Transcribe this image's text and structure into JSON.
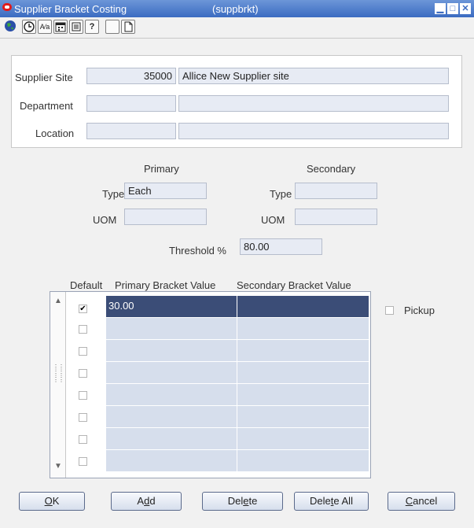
{
  "window": {
    "title": "Supplier Bracket Costing",
    "subtitle": "(suppbrkt)",
    "controls": [
      "minimize",
      "maximize",
      "close"
    ]
  },
  "toolbar": {
    "icons": [
      "globe-icon",
      "clock-icon",
      "find-icon",
      "calendar-icon",
      "form-icon",
      "help-icon",
      "blank-icon",
      "new-doc-icon"
    ]
  },
  "header": {
    "supplier_site_label": "Supplier Site",
    "supplier_site_id": "35000",
    "supplier_site_name": "Allice New Supplier site",
    "department_label": "Department",
    "department_id": "",
    "department_name": "",
    "location_label": "Location",
    "location_id": "",
    "location_name": ""
  },
  "uom_section": {
    "primary_label": "Primary",
    "secondary_label": "Secondary",
    "primary_type_label": "Type",
    "primary_type_value": "Each",
    "primary_uom_label": "UOM",
    "primary_uom_value": "",
    "secondary_type_label": "Type",
    "secondary_type_value": "",
    "secondary_uom_label": "UOM",
    "secondary_uom_value": "",
    "threshold_label": "Threshold %",
    "threshold_value": "80.00"
  },
  "grid": {
    "columns": [
      "Default",
      "Primary Bracket Value",
      "Secondary Bracket Value"
    ],
    "rows": [
      {
        "default": true,
        "primary": "30.00",
        "secondary": "",
        "selected": true
      },
      {
        "default": false,
        "primary": "",
        "secondary": "",
        "selected": false
      },
      {
        "default": false,
        "primary": "",
        "secondary": "",
        "selected": false
      },
      {
        "default": false,
        "primary": "",
        "secondary": "",
        "selected": false
      },
      {
        "default": false,
        "primary": "",
        "secondary": "",
        "selected": false
      },
      {
        "default": false,
        "primary": "",
        "secondary": "",
        "selected": false
      },
      {
        "default": false,
        "primary": "",
        "secondary": "",
        "selected": false
      },
      {
        "default": false,
        "primary": "",
        "secondary": "",
        "selected": false
      }
    ]
  },
  "pickup": {
    "label": "Pickup",
    "checked": false
  },
  "buttons": {
    "ok": {
      "pre": "",
      "u": "O",
      "post": "K"
    },
    "add": {
      "pre": "A",
      "u": "d",
      "post": "d"
    },
    "delete": {
      "pre": "Del",
      "u": "e",
      "post": "te"
    },
    "delete_all": {
      "pre": "Dele",
      "u": "t",
      "post": "e All"
    },
    "cancel": {
      "pre": "",
      "u": "C",
      "post": "ancel"
    }
  },
  "colors": {
    "titlebar": "#3b6bc1",
    "field_bg": "#e7ebf4",
    "grid_cell": "#d6deec",
    "grid_selected": "#3b4d77"
  }
}
